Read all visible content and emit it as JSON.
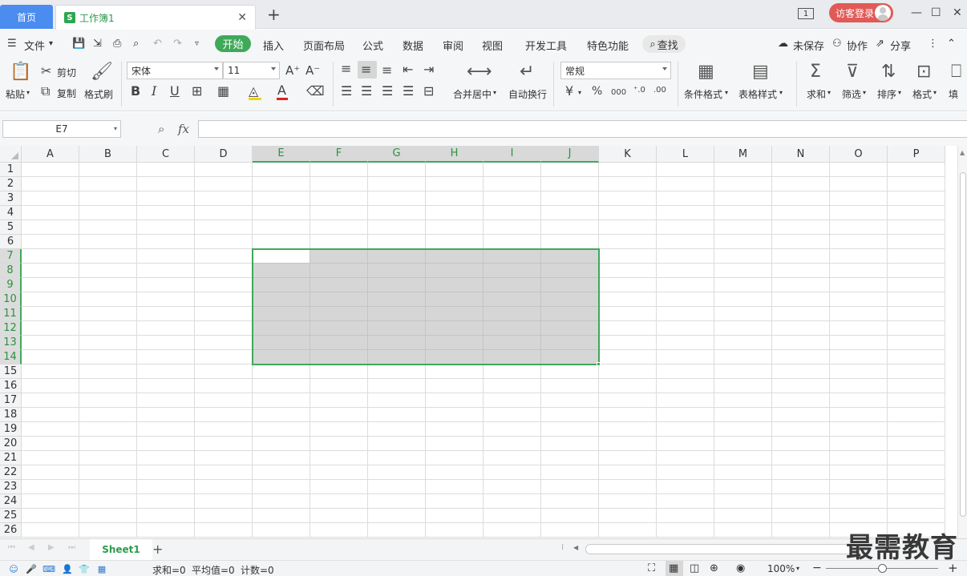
{
  "tabs": {
    "home": "首页",
    "doc_logo": "S",
    "doc_title": "工作簿1",
    "close": "✕",
    "add": "+"
  },
  "window": {
    "win_count": "1",
    "login": "访客登录",
    "minimize": "—",
    "maximize": "☐",
    "close": "✕"
  },
  "menu": {
    "file": "文件",
    "items": [
      "开始",
      "插入",
      "页面布局",
      "公式",
      "数据",
      "审阅",
      "视图",
      "开发工具",
      "特色功能"
    ],
    "search": "查找",
    "unsaved": "未保存",
    "collab": "协作",
    "share": "分享"
  },
  "ribbon": {
    "paste": "粘贴",
    "cut": "剪切",
    "copy": "复制",
    "format_painter": "格式刷",
    "font_name": "宋体",
    "font_size": "11",
    "bold": "B",
    "italic": "I",
    "underline": "U",
    "merge_center": "合并居中",
    "wrap_text": "自动换行",
    "number_format": "常规",
    "currency": "¥",
    "percent": "%",
    "thousands": "000",
    "cond_format": "条件格式",
    "table_style": "表格样式",
    "sum": "求和",
    "filter": "筛选",
    "sort": "排序",
    "format": "格式",
    "fill": "填"
  },
  "formula": {
    "name_box": "E7",
    "fx": "fx",
    "value": ""
  },
  "grid": {
    "columns": [
      "A",
      "B",
      "C",
      "D",
      "E",
      "F",
      "G",
      "H",
      "I",
      "J",
      "K",
      "L",
      "M",
      "N",
      "O",
      "P"
    ],
    "rows": [
      "1",
      "2",
      "3",
      "4",
      "5",
      "6",
      "7",
      "8",
      "9",
      "10",
      "11",
      "12",
      "13",
      "14",
      "15",
      "16",
      "17",
      "18",
      "19",
      "20",
      "21",
      "22",
      "23",
      "24",
      "25",
      "26"
    ],
    "selected_columns": [
      "E",
      "F",
      "G",
      "H",
      "I",
      "J"
    ],
    "selected_rows": [
      "7",
      "8",
      "9",
      "10",
      "11",
      "12",
      "13",
      "14"
    ],
    "active_cell": "E7"
  },
  "sheets": {
    "tabs": [
      "Sheet1"
    ],
    "add": "+"
  },
  "status": {
    "sum": "求和=0",
    "average": "平均值=0",
    "count": "计数=0",
    "zoom": "100%",
    "zoom_value": 100
  },
  "watermark": "最需教育",
  "colors": {
    "accent_green": "#3fa95a",
    "tab_blue": "#4a8cf0",
    "login_red": "#e05a57",
    "selection_gray": "#d6d6d6"
  }
}
